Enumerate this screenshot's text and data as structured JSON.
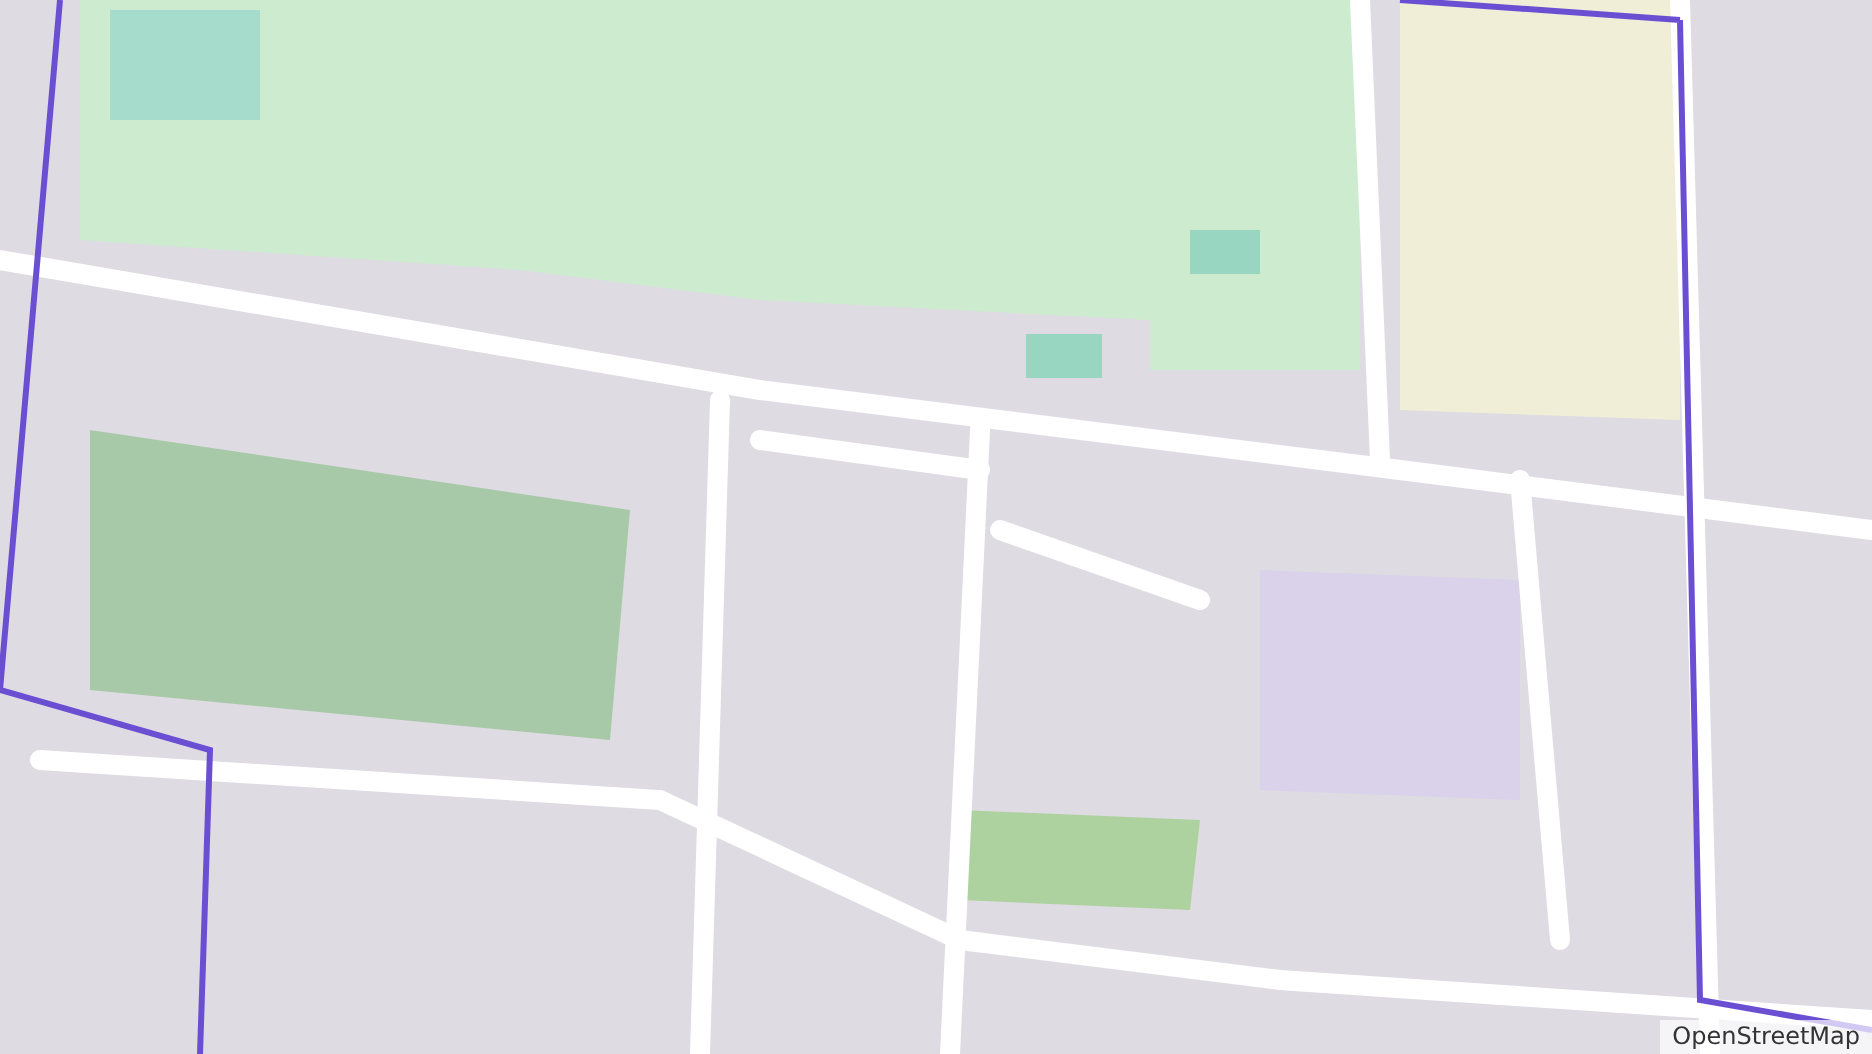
{
  "map": {
    "attribution": "OpenStreetMap"
  }
}
